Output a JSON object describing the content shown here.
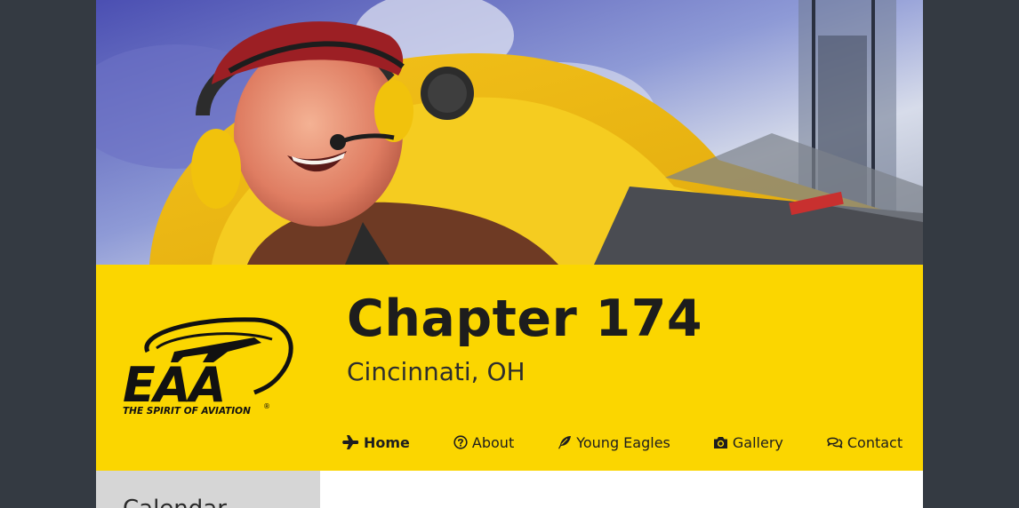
{
  "header": {
    "hero_alt": "Pilot in cockpit",
    "logo": {
      "wordmark": "EAA",
      "tagline": "THE SPIRIT OF AVIATION",
      "registered": "®"
    },
    "title": "Chapter 174",
    "subtitle": "Cincinnati, OH"
  },
  "nav": {
    "items": [
      {
        "label": "Home",
        "icon": "plane-icon",
        "active": true
      },
      {
        "label": "About",
        "icon": "question-circle-icon",
        "active": false
      },
      {
        "label": "Young Eagles",
        "icon": "feather-icon",
        "active": false
      },
      {
        "label": "Gallery",
        "icon": "camera-icon",
        "active": false
      },
      {
        "label": "Contact",
        "icon": "comments-icon",
        "active": false
      }
    ]
  },
  "sidebar": {
    "heading": "Calendar"
  },
  "colors": {
    "page_bg": "#343a42",
    "band": "#fbd600",
    "sidebar": "#d6d6d6",
    "text": "#1d1d1d"
  }
}
